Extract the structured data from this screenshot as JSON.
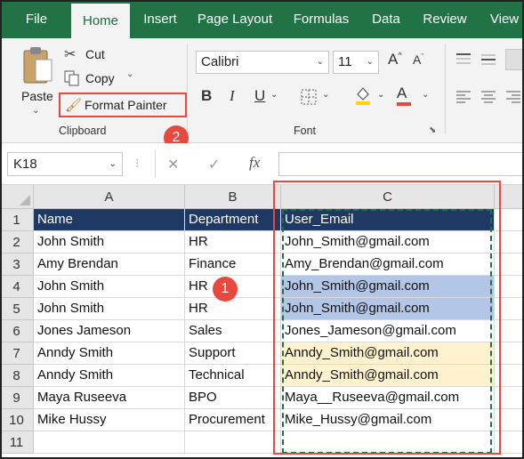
{
  "ribbon": {
    "tabs": [
      "File",
      "Home",
      "Insert",
      "Page Layout",
      "Formulas",
      "Data",
      "Review",
      "View"
    ],
    "active_tab": "Home",
    "clipboard": {
      "paste_label": "Paste",
      "cut_label": "Cut",
      "copy_label": "Copy",
      "format_painter_label": "Format Painter",
      "group_label": "Clipboard"
    },
    "font": {
      "font_name": "Calibri",
      "font_size": "11",
      "group_label": "Font",
      "bold_glyph": "B",
      "italic_glyph": "I",
      "underline_glyph": "U",
      "font_color_glyph": "A",
      "grow_glyph": "A",
      "shrink_glyph": "A"
    }
  },
  "formula_bar": {
    "name_box": "K18",
    "cancel_glyph": "✕",
    "enter_glyph": "✓",
    "fx_glyph": "fx"
  },
  "sheet": {
    "columns": [
      "A",
      "B",
      "C"
    ],
    "rows": [
      "1",
      "2",
      "3",
      "4",
      "5",
      "6",
      "7",
      "8",
      "9",
      "10",
      "11"
    ],
    "cells": [
      [
        "Name",
        "Department",
        "User_Email"
      ],
      [
        "John Smith",
        "HR",
        "John_Smith@gmail.com"
      ],
      [
        "Amy Brendan",
        "Finance",
        "Amy_Brendan@gmail.com"
      ],
      [
        "John Smith",
        "HR",
        "John_Smith@gmail.com"
      ],
      [
        "John Smith",
        "HR",
        "John_Smith@gmail.com"
      ],
      [
        "Jones Jameson",
        "Sales",
        "Jones_Jameson@gmail.com"
      ],
      [
        "Anndy Smith",
        "Support",
        "Anndy_Smith@gmail.com"
      ],
      [
        "Anndy Smith",
        "Technical",
        "Anndy_Smith@gmail.com"
      ],
      [
        "Maya  Ruseeva",
        "BPO",
        "Maya__Ruseeva@gmail.com"
      ],
      [
        "Mike Hussy",
        "Procurement",
        "Mike_Hussy@gmail.com"
      ],
      [
        "",
        "",
        ""
      ]
    ],
    "header_fill": "#1F3864",
    "blue_highlight": "#B4C6E7",
    "yellow_highlight": "#FFF2CC"
  },
  "annotations": {
    "step1": "1",
    "step2": "2",
    "color": "#E8483E"
  }
}
